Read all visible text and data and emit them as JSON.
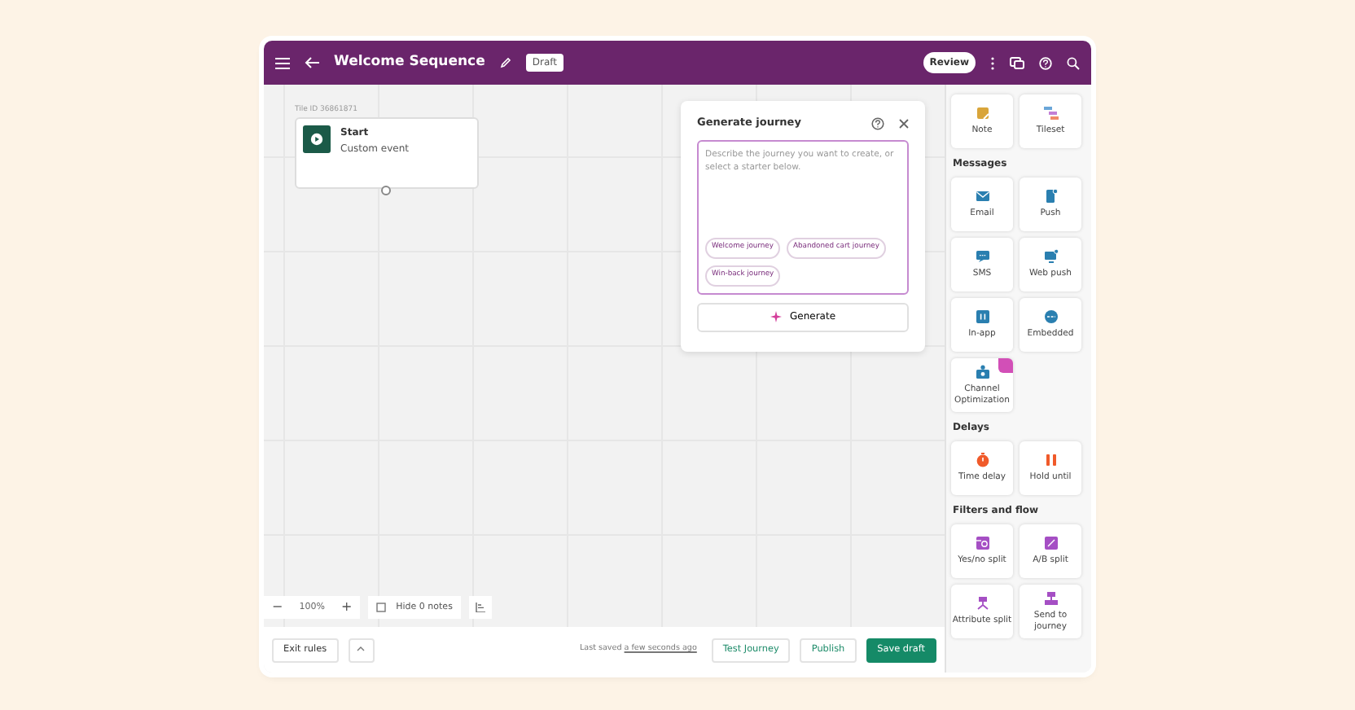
{
  "header": {
    "title": "Welcome Sequence",
    "status": "Draft",
    "review": "Review"
  },
  "canvas": {
    "tile_id": "Tile ID 36861871",
    "start_node": {
      "title": "Start",
      "subtitle": "Custom event"
    }
  },
  "generate_panel": {
    "title": "Generate journey",
    "placeholder": "Describe the journey you want to create, or select a starter below.",
    "starters": [
      "Welcome journey",
      "Abandoned cart journey",
      "Win-back journey"
    ],
    "button": "Generate"
  },
  "zoom": {
    "value": "100%",
    "minus": "−",
    "plus": "+"
  },
  "notes_button": "Hide 0 notes",
  "sidebar": {
    "sections": [
      {
        "items": [
          {
            "label": "Note",
            "kind": "note",
            "flagged": false
          },
          {
            "label": "Tileset",
            "kind": "tileset",
            "flagged": false
          }
        ]
      },
      {
        "title": "Messages",
        "items": [
          {
            "label": "Email",
            "kind": "email",
            "flagged": false
          },
          {
            "label": "Push",
            "kind": "push",
            "flagged": false
          },
          {
            "label": "SMS",
            "kind": "sms",
            "flagged": false
          },
          {
            "label": "Web push",
            "kind": "webpush",
            "flagged": false
          },
          {
            "label": "In-app",
            "kind": "inapp",
            "flagged": false
          },
          {
            "label": "Embedded",
            "kind": "embedded",
            "flagged": false
          },
          {
            "label": "Channel Optimization",
            "kind": "optimization",
            "flagged": true
          }
        ]
      },
      {
        "title": "Delays",
        "items": [
          {
            "label": "Time delay",
            "kind": "timer",
            "flagged": false
          },
          {
            "label": "Hold until",
            "kind": "hold",
            "flagged": false
          }
        ]
      },
      {
        "title": "Filters and flow",
        "items": [
          {
            "label": "Yes/no split",
            "kind": "yesno",
            "flagged": false
          },
          {
            "label": "A/B split",
            "kind": "ab",
            "flagged": false
          },
          {
            "label": "Attribute split",
            "kind": "attribute",
            "flagged": false
          },
          {
            "label": "Send to journey",
            "kind": "send",
            "flagged": false
          }
        ]
      }
    ]
  },
  "footer": {
    "exit_rules": "Exit rules",
    "last_saved": "Last saved",
    "saved_time": "a few seconds ago",
    "test": "Test Journey",
    "publish": "Publish",
    "save": "Save draft"
  }
}
